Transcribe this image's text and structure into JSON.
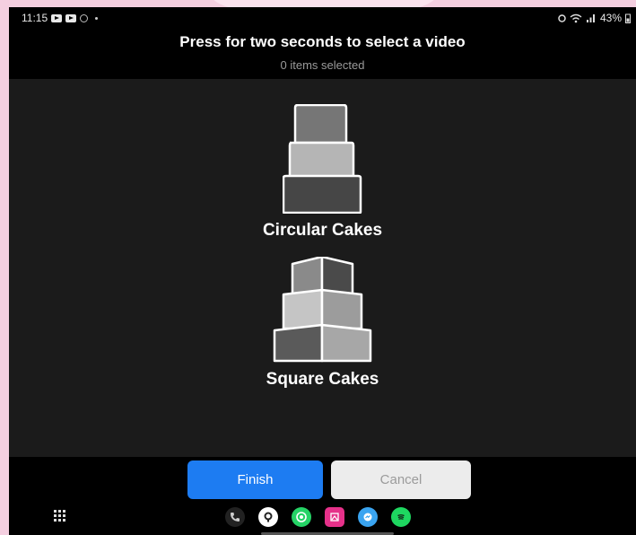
{
  "status_bar": {
    "time": "11:15",
    "battery": "43%",
    "icons": [
      "youtube-icon",
      "youtube-icon",
      "settings-icon",
      "dot-icon",
      "alarm-icon",
      "wifi-icon",
      "signal-icon",
      "battery-icon"
    ]
  },
  "header": {
    "title": "Press for two seconds to select a video",
    "subtitle": "0 items selected"
  },
  "categories": [
    {
      "label": "Circular Cakes",
      "icon": "circular-cake-icon"
    },
    {
      "label": "Square Cakes",
      "icon": "square-cake-icon"
    }
  ],
  "footer": {
    "finish_label": "Finish",
    "cancel_label": "Cancel"
  },
  "dock": {
    "apps": [
      "phone-icon",
      "maps-icon",
      "whatsapp-icon",
      "photo-editor-icon",
      "messenger-icon",
      "spotify-icon"
    ]
  },
  "colors": {
    "accent": "#1d7cf2",
    "background": "#1b1b1b",
    "cancel_bg": "#ececec"
  }
}
